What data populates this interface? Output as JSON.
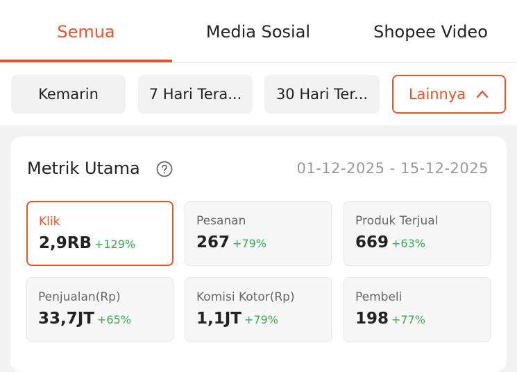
{
  "tabs": [
    {
      "label": "Semua",
      "active": true
    },
    {
      "label": "Media Sosial",
      "active": false
    },
    {
      "label": "Shopee Video",
      "active": false
    }
  ],
  "filters": [
    {
      "label": "Kemarin"
    },
    {
      "label": "7 Hari Tera..."
    },
    {
      "label": "30 Hari Ter..."
    },
    {
      "label": "Lainnya",
      "icon": "chevron-up-icon",
      "active": true
    }
  ],
  "metrics_card": {
    "title": "Metrik Utama",
    "help_icon": "question-circle-icon",
    "date_range": "01-12-2025 - 15-12-2025",
    "items": [
      {
        "label": "Klik",
        "value": "2,9RB",
        "change": "+129%",
        "selected": true
      },
      {
        "label": "Pesanan",
        "value": "267",
        "change": "+79%"
      },
      {
        "label": "Produk Terjual",
        "value": "669",
        "change": "+63%"
      },
      {
        "label": "Penjualan(Rp)",
        "value": "33,7JT",
        "change": "+65%"
      },
      {
        "label": "Komisi Kotor(Rp)",
        "value": "1,1JT",
        "change": "+79%"
      },
      {
        "label": "Pembeli",
        "value": "198",
        "change": "+77%"
      }
    ]
  },
  "colors": {
    "accent": "#e4572e",
    "positive": "#3aa655",
    "muted": "#9a9a9a",
    "background": "#f2f2f2"
  }
}
